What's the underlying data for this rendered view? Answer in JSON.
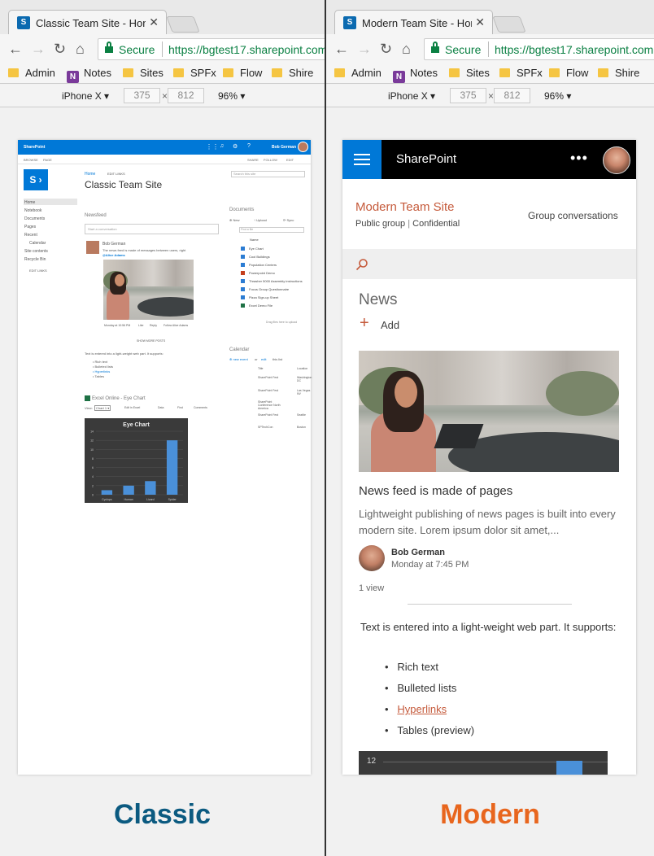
{
  "left": {
    "tab_title": "Classic Team Site - Home",
    "secure_label": "Secure",
    "url": "https://bgtest17.sharepoint.com",
    "bookmarks": [
      "Admin",
      "Notes",
      "Sites",
      "SPFx",
      "Flow",
      "Shire"
    ],
    "device": "iPhone X",
    "width": "375",
    "height": "812",
    "zoom": "96%",
    "caption": "Classic",
    "caption_color": "#0b5a80",
    "classic": {
      "suite_title": "SharePoint",
      "user": "Bob German",
      "ribbon_browse": "BROWSE",
      "ribbon_page": "PAGE",
      "ribbon_actions": [
        "SHARE",
        "FOLLOW",
        "EDIT"
      ],
      "breadcrumb": "Home",
      "edit_links": "EDIT LINKS",
      "site_title": "Classic Team Site",
      "search_placeholder": "Search this site",
      "nav": [
        "Home",
        "Notebook",
        "Documents",
        "Pages",
        "Recent",
        "Calendar",
        "Site contents",
        "Recycle Bin"
      ],
      "nav_edit": "EDIT LINKS",
      "newsfeed_title": "Newsfeed",
      "conversation_placeholder": "Start a conversation",
      "post_author": "Bob German",
      "post_text": "The news feed is made of messages between users, right",
      "post_mention": "@Alice Adams",
      "post_meta": "Monday at 10:56 PM",
      "post_actions": [
        "Like",
        "Reply",
        "Follow Alice Adams"
      ],
      "show_more": "SHOW MORE POSTS",
      "webpart_text": "Text is entered into a light-weight web part. It supports:",
      "webpart_items": [
        "Rich text",
        "Bulleted lists",
        "Hyperlinks",
        "Tables"
      ],
      "excel_title": "Excel Online - Eye Chart",
      "excel_view_label": "View:",
      "excel_view_value": "Chart 1",
      "excel_actions": [
        "Edit in Excel",
        "Data",
        "Find",
        "Comments"
      ],
      "documents_title": "Documents",
      "documents_actions": [
        "New",
        "Upload",
        "Sync"
      ],
      "find_file": "Find a file",
      "docs_header": "Name",
      "docs": [
        "Eye Chart",
        "Cool Buildings",
        "Population Centers",
        "Powerpoint Demo",
        "Thrasher 5000 Assembly instructions",
        "Focus Group Questionnaire",
        "Pizza Sign-up Sheet",
        "Excel Demo File"
      ],
      "drag_hint": "Drag files here to upload",
      "calendar_title": "Calendar",
      "calendar_new": "new event",
      "calendar_or": "or",
      "calendar_edit": "edit",
      "calendar_rest": "this list",
      "cal_col_title": "Title",
      "cal_col_location": "Location",
      "events": [
        {
          "title": "SharePoint Fest",
          "location": "Washington DC"
        },
        {
          "title": "SharePoint Fest",
          "location": "Las Vegas NV"
        },
        {
          "title": "SharePoint Conference North America",
          "location": ""
        },
        {
          "title": "SharePoint Fest",
          "location": "Seattle"
        },
        {
          "title": "SPTechCon",
          "location": "Boston"
        }
      ]
    },
    "chart_data": {
      "type": "bar",
      "title": "Eye Chart",
      "categories": [
        "Cyclops",
        "Human",
        "Lizard",
        "Spider"
      ],
      "values": [
        1,
        2,
        3,
        12
      ],
      "ylim": [
        0,
        14
      ],
      "yticks": [
        "14",
        "12",
        "10",
        "8",
        "6",
        "4",
        "2",
        "0"
      ],
      "bar_color": "#4a90d9",
      "grid": true
    }
  },
  "right": {
    "tab_title": "Modern Team Site - Home",
    "secure_label": "Secure",
    "url": "https://bgtest17.sharepoint.com",
    "bookmarks": [
      "Admin",
      "Notes",
      "Sites",
      "SPFx",
      "Flow",
      "Shire"
    ],
    "device": "iPhone X",
    "width": "375",
    "height": "812",
    "zoom": "96%",
    "caption": "Modern",
    "caption_color": "#e8661e",
    "modern": {
      "app_title": "SharePoint",
      "site_title": "Modern Team Site",
      "site_meta_1": "Public group",
      "site_meta_sep": "|",
      "site_meta_2": "Confidential",
      "group_conversations": "Group conversations",
      "news_title": "News",
      "add_label": "Add",
      "article_title": "News feed is made of pages",
      "article_desc": "Lightweight publishing of news pages is built into every modern site. Lorem ipsum dolor sit amet,...",
      "author": "Bob German",
      "date": "Monday at 7:45 PM",
      "views": "1 view",
      "text": "Text is entered into a light-weight web part. It supports:",
      "items": [
        "Rich text",
        "Bulleted lists",
        "Hyperlinks",
        "Tables (preview)"
      ],
      "chart_top_tick": "12",
      "accent": "#c55a3b"
    }
  }
}
